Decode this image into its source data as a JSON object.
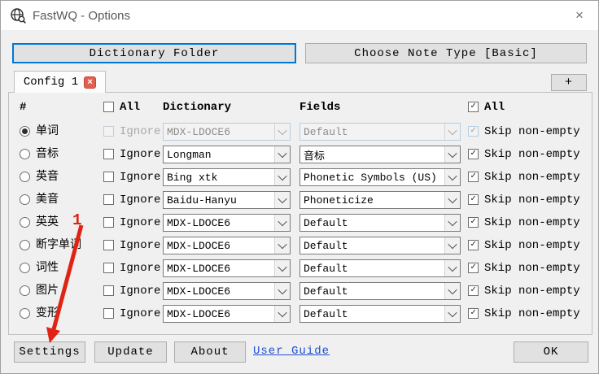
{
  "colors": {
    "accent": "#0078d7",
    "annotation": "#e02413",
    "link": "#1d4fd0",
    "tab-close": "#e2604e"
  },
  "window": {
    "title": "FastWQ - Options",
    "close_glyph": "×"
  },
  "toolbar": {
    "dictionary_folder_label": "Dictionary Folder",
    "choose_note_type_label": "Choose Note Type [Basic]"
  },
  "tabs": {
    "active_label": "Config 1",
    "close_glyph": "×",
    "add_label": "+"
  },
  "table": {
    "headers": {
      "index": "#",
      "all_left": "All",
      "dictionary": "Dictionary",
      "fields": "Fields",
      "all_right": "All"
    },
    "all_left_checked": false,
    "all_right_checked": true,
    "ignore_label": "Ignore",
    "skip_label": "Skip non-empty",
    "rows": [
      {
        "label": "单词",
        "selected": true,
        "disabled": true,
        "ignore": false,
        "dictionary": "MDX-LDOCE6",
        "fields": "Default",
        "skip": true
      },
      {
        "label": "音标",
        "selected": false,
        "disabled": false,
        "ignore": false,
        "dictionary": "Longman",
        "fields": "音标",
        "skip": true
      },
      {
        "label": "英音",
        "selected": false,
        "disabled": false,
        "ignore": false,
        "dictionary": "Bing xtk",
        "fields": "Phonetic Symbols (US)",
        "skip": true
      },
      {
        "label": "美音",
        "selected": false,
        "disabled": false,
        "ignore": false,
        "dictionary": "Baidu-Hanyu",
        "fields": "Phoneticize",
        "skip": true
      },
      {
        "label": "英英",
        "selected": false,
        "disabled": false,
        "ignore": false,
        "dictionary": "MDX-LDOCE6",
        "fields": "Default",
        "skip": true
      },
      {
        "label": "断字单词",
        "selected": false,
        "disabled": false,
        "ignore": false,
        "dictionary": "MDX-LDOCE6",
        "fields": "Default",
        "skip": true
      },
      {
        "label": "词性",
        "selected": false,
        "disabled": false,
        "ignore": false,
        "dictionary": "MDX-LDOCE6",
        "fields": "Default",
        "skip": true
      },
      {
        "label": "图片",
        "selected": false,
        "disabled": false,
        "ignore": false,
        "dictionary": "MDX-LDOCE6",
        "fields": "Default",
        "skip": true
      },
      {
        "label": "变形",
        "selected": false,
        "disabled": false,
        "ignore": false,
        "dictionary": "MDX-LDOCE6",
        "fields": "Default",
        "skip": true
      }
    ]
  },
  "annotation": {
    "number": "1"
  },
  "footer": {
    "settings_label": "Settings",
    "update_label": "Update",
    "about_label": "About",
    "user_guide_label": "User Guide",
    "ok_label": "OK"
  }
}
